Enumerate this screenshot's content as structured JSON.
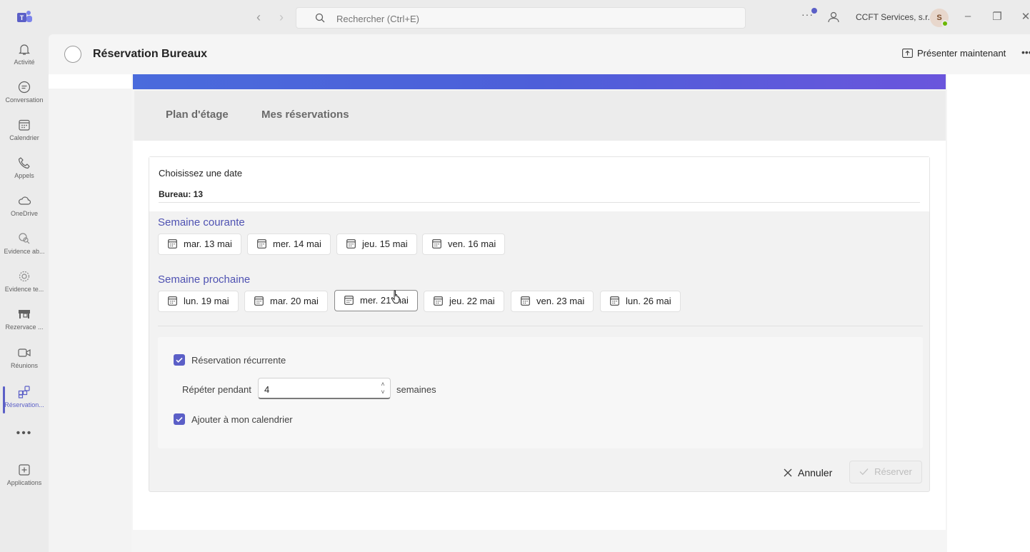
{
  "titlebar": {
    "search_placeholder": "Rechercher (Ctrl+E)",
    "org_name": "CCFT Services, s.r.o.",
    "avatar_initial": "S",
    "more": "···"
  },
  "rail": {
    "items": [
      {
        "label": "Activité",
        "icon": "bell-icon"
      },
      {
        "label": "Conversation",
        "icon": "chat-icon"
      },
      {
        "label": "Calendrier",
        "icon": "calendar-icon"
      },
      {
        "label": "Appels",
        "icon": "phone-icon"
      },
      {
        "label": "OneDrive",
        "icon": "cloud-icon"
      },
      {
        "label": "Evidence ab...",
        "icon": "people-search-icon"
      },
      {
        "label": "Evidence te...",
        "icon": "gear-icon"
      },
      {
        "label": "Rezervace ...",
        "icon": "desk-icon"
      },
      {
        "label": "Réunions",
        "icon": "video-icon"
      },
      {
        "label": "Réservation...",
        "icon": "apps-grid-icon"
      },
      {
        "label": "Applications",
        "icon": "plus-square-icon"
      }
    ],
    "more": "•••"
  },
  "header": {
    "title": "Réservation Bureaux",
    "present_label": "Présenter maintenant",
    "more": "•••"
  },
  "tabs": {
    "floor_plan": "Plan d'étage",
    "my_reservations": "Mes réservations"
  },
  "booking": {
    "choose_date": "Choisissez une date",
    "desk_label": "Bureau: 13",
    "current_week_label": "Semaine courante",
    "current_week": [
      "mar. 13 mai",
      "mer. 14 mai",
      "jeu. 15 mai",
      "ven. 16 mai"
    ],
    "next_week_label": "Semaine prochaine",
    "next_week": [
      "lun. 19 mai",
      "mar. 20 mai",
      "mer. 21 mai",
      "jeu. 22 mai",
      "ven. 23 mai",
      "lun. 26 mai"
    ],
    "selected_date": "mer. 21 mai",
    "recurrent_label": "Réservation récurrente",
    "recurrent_checked": true,
    "repeat_label": "Répéter pendant",
    "repeat_value": "4",
    "weeks_unit": "semaines",
    "add_calendar_label": "Ajouter à mon calendrier",
    "add_calendar_checked": true,
    "cancel_label": "Annuler",
    "reserve_label": "Réserver"
  },
  "colors": {
    "accent": "#5b5fc7",
    "week_label": "#4f52b2",
    "banner_start": "#4a6bdc",
    "banner_end": "#6a55dc"
  }
}
